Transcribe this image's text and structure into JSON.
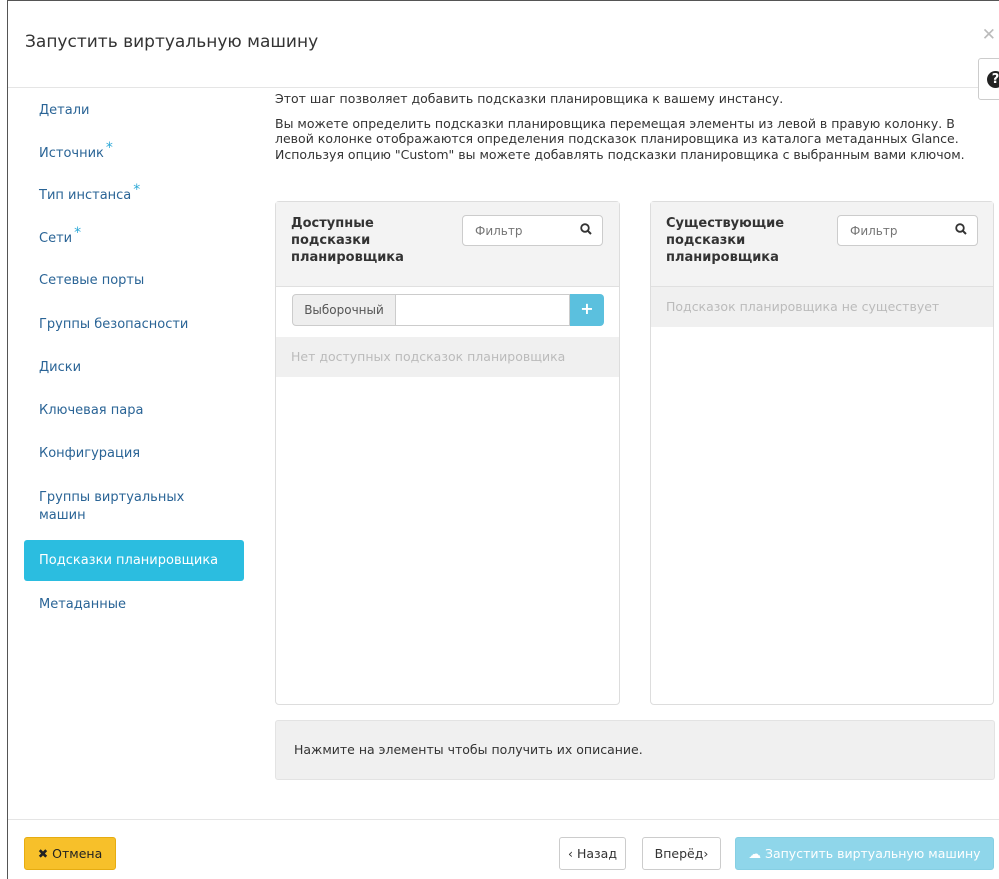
{
  "modal": {
    "title": "Запустить виртуальную машину",
    "close_glyph": "✕",
    "help_glyph": "?"
  },
  "nav": {
    "items": [
      {
        "label": "Детали",
        "required": false,
        "active": false
      },
      {
        "label": "Источник",
        "required": true,
        "active": false
      },
      {
        "label": "Тип инстанса",
        "required": true,
        "active": false
      },
      {
        "label": "Сети",
        "required": true,
        "active": false
      },
      {
        "label": "Сетевые порты",
        "required": false,
        "active": false
      },
      {
        "label": "Группы безопасности",
        "required": false,
        "active": false
      },
      {
        "label": "Диски",
        "required": false,
        "active": false
      },
      {
        "label": "Ключевая пара",
        "required": false,
        "active": false
      },
      {
        "label": "Конфигурация",
        "required": false,
        "active": false
      },
      {
        "label": "Группы виртуальных машин",
        "required": false,
        "active": false
      },
      {
        "label": "Подсказки планировщика",
        "required": false,
        "active": true
      },
      {
        "label": "Метаданные",
        "required": false,
        "active": false
      }
    ],
    "required_mark": "*"
  },
  "content": {
    "intro1": "Этот шаг позволяет добавить подсказки планировщика к вашему инстансу.",
    "intro2": "Вы можете определить подсказки планировщика перемещая элементы из левой в правую колонку. В левой колонке отображаются определения подсказок планировщика из каталога метаданных Glance. Используя опцию \"Custom\" вы можете добавлять подсказки планировщика с выбранным вами ключом.",
    "available": {
      "title": "Доступные подсказки планировщика",
      "filter_placeholder": "Фильтр",
      "custom_label": "Выборочный",
      "custom_value": "",
      "add_glyph": "+",
      "empty_text": "Нет доступных подсказок планировщика"
    },
    "existing": {
      "title": "Существующие подсказки планировщика",
      "filter_placeholder": "Фильтр",
      "empty_text": "Подсказок планировщика не существует"
    },
    "description": "Нажмите на элементы чтобы получить их описание."
  },
  "footer": {
    "cancel": "✖ Отмена",
    "back": "‹ Назад",
    "next": "Вперёд›",
    "launch": "☁ Запустить виртуальную машину"
  },
  "colors": {
    "accent": "#2bbde0",
    "cancel": "#f7c02a",
    "launch_disabled": "#8fd6ea",
    "link": "#2a6496"
  }
}
